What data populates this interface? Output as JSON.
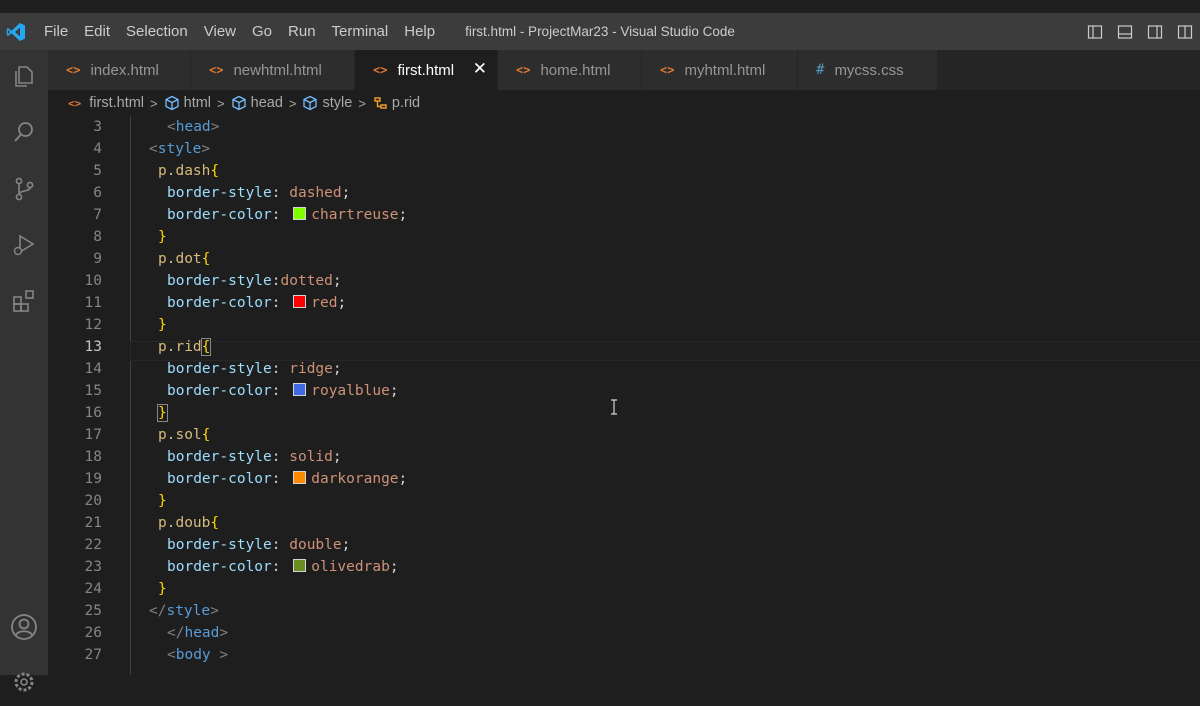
{
  "menu": [
    "File",
    "Edit",
    "Selection",
    "View",
    "Go",
    "Run",
    "Terminal",
    "Help"
  ],
  "window_title": "first.html - ProjectMar23 - Visual Studio Code",
  "tabs": [
    {
      "label": "index.html",
      "icon": "html-file-icon"
    },
    {
      "label": "newhtml.html",
      "icon": "html-file-icon"
    },
    {
      "label": "first.html",
      "icon": "html-file-icon",
      "active": true
    },
    {
      "label": "home.html",
      "icon": "html-file-icon"
    },
    {
      "label": "myhtml.html",
      "icon": "html-file-icon"
    },
    {
      "label": "mycss.css",
      "icon": "css-file-icon"
    }
  ],
  "tab_close_glyph": "✕",
  "breadcrumb": [
    "first.html",
    "html",
    "head",
    "style",
    "p.rid"
  ],
  "line_numbers": [
    "3",
    "4",
    "5",
    "6",
    "7",
    "8",
    "9",
    "10",
    "11",
    "12",
    "13",
    "14",
    "15",
    "16",
    "17",
    "18",
    "19",
    "20",
    "21",
    "22",
    "23",
    "24",
    "25",
    "26",
    "27"
  ],
  "current_line": "13",
  "code": {
    "l3": "head",
    "l4": "style",
    "l5_sel": "p.dash",
    "l6_prop": "border-style",
    "l6_val": "dashed",
    "l7_prop": "border-color",
    "l7_val": "chartreuse",
    "l9_sel": "p.dot",
    "l10_prop": "border-style",
    "l10_val": "dotted",
    "l11_prop": "border-color",
    "l11_val": "red",
    "l13_sel": "p.rid",
    "l14_prop": "border-style",
    "l14_val": "ridge",
    "l15_prop": "border-color",
    "l15_val": "royalblue",
    "l17_sel": "p.sol",
    "l18_prop": "border-style",
    "l18_val": "solid",
    "l19_prop": "border-color",
    "l19_val": "darkorange",
    "l21_sel": "p.doub",
    "l22_prop": "border-style",
    "l22_val": "double",
    "l23_prop": "border-color",
    "l23_val": "olivedrab",
    "l25": "style",
    "l26": "head",
    "l27": "body"
  },
  "swatch_colors": {
    "chartreuse": "#7fff00",
    "red": "#ff0000",
    "royalblue": "#4169e1",
    "darkorange": "#ff8c00",
    "olivedrab": "#6b8e23"
  },
  "colors": {
    "accent": "#007acc",
    "editor_bg": "#1e1e1e",
    "titlebar_bg": "#3c3c3c",
    "activitybar_bg": "#333333"
  }
}
